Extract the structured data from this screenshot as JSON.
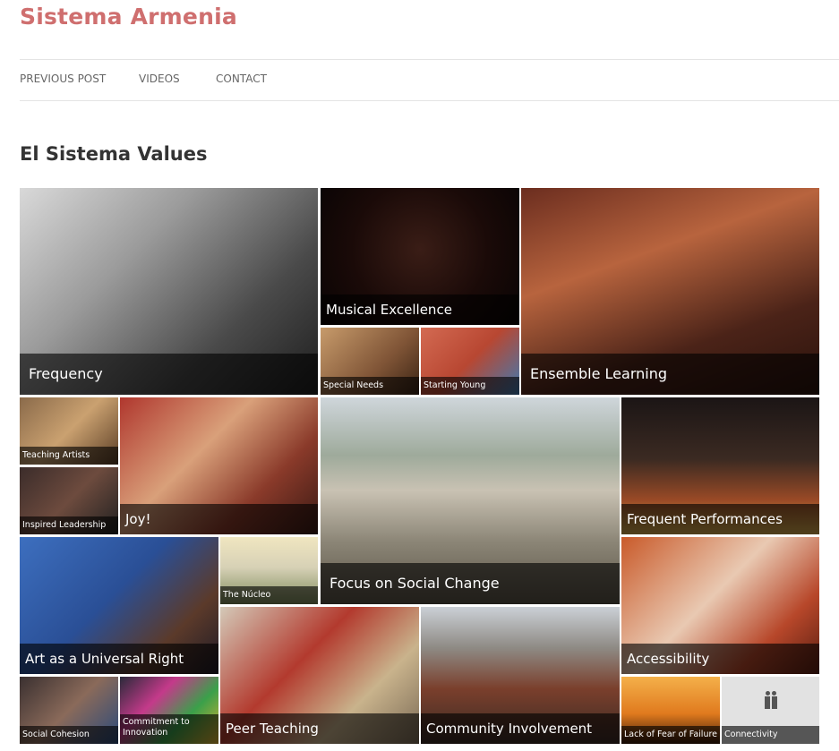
{
  "site": {
    "title": "Sistema Armenia"
  },
  "nav": {
    "items": [
      "PREVIOUS POST",
      "VIDEOS",
      "CONTACT"
    ]
  },
  "page": {
    "heading": "El Sistema Values"
  },
  "tiles": {
    "frequency": "Frequency",
    "musical_excellence": "Musical Excellence",
    "special_needs": "Special Needs",
    "starting_young": "Starting Young",
    "ensemble_learning": "Ensemble Learning",
    "teaching_artists": "Teaching Artists",
    "inspired_leadership": "Inspired Leadership",
    "joy": "Joy!",
    "focus_social_change": "Focus on Social Change",
    "frequent_performances": "Frequent Performances",
    "art_universal_right": "Art as a Universal Right",
    "the_nucleo": "The Núcleo",
    "accessibility": "Accessibility",
    "peer_teaching": "Peer Teaching",
    "community_involvement": "Community Involvement",
    "social_cohesion": "Social Cohesion",
    "commitment_innovation": "Commitment to Innovation",
    "lack_fear_failure": "Lack of Fear of Failure",
    "connectivity": "Connectivity"
  },
  "colors": {
    "title": "#cf6f6f",
    "caption_bg": "rgba(0,0,0,0.62)"
  }
}
